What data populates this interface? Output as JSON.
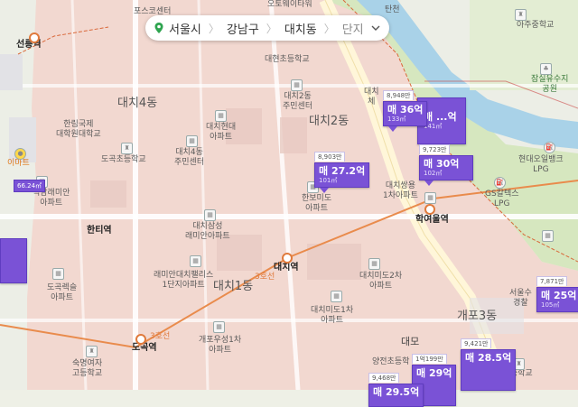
{
  "breadcrumb": {
    "city": "서울시",
    "district": "강남구",
    "dong": "대치동",
    "mode": "단지"
  },
  "labels": {
    "posco": "포스코센터",
    "okwoodwood": "오토웨이타워",
    "seolleung": "선릉역",
    "daecheon_school": "대현초등학교",
    "daechi4": "대치4동",
    "daechi2_center": "대치2동\n주민센터",
    "daechi2": "대치2동",
    "hanlim": "한림국제\n대학원대학교",
    "daechi_hyundai": "대치현대\n아파트",
    "dogok_school": "도곡초등학교",
    "daechi4_center": "대치4동\n주민센터",
    "emart": "이마트",
    "yeoksam_raemian": "역삼래미안\n아파트",
    "hanbo_mido": "한보미도\n아파트",
    "daechi_samsung": "대치삼성\n래미안아파트",
    "hanti": "한티역",
    "raemian_palace": "래미안대치팰리스\n1단지아파트",
    "daechi_stn": "대치역",
    "daechi1": "대치1동",
    "dogok_rexle": "도곡렉슬\n아파트",
    "daechi_mido2": "대치미도2차\n아파트",
    "daechi_mido1": "대치미도1차\n아파트",
    "gaepo_woosung": "개포우성1차\n아파트",
    "dogok_stn": "도곡역",
    "sookmyung": "숙명여자\n고등학교",
    "tancheon": "탄천",
    "ajoo_school": "아주중학교",
    "jamsil_park": "잠실유수지\n공원",
    "hyundai_lpg": "현대오일뱅크\nLPG",
    "gs_lpg": "GS칼텍스\nLPG",
    "hakyeoul": "학여울역",
    "daechi_hwa": "대치쌍용\n1차아파트",
    "gaepo3": "개포3동",
    "seoul_school": "서울수\n경찰",
    "ilwon_school": "일원초등학교",
    "yangjeon": "양전초등학",
    "daemo": "대모",
    "daechi_che": "대치\n체",
    "line3": "3호선"
  },
  "pins": [
    {
      "count": "8,948만",
      "price": "매 36억",
      "area": "133㎡"
    },
    {
      "count": "",
      "price": "매 ...억",
      "area": "141㎡"
    },
    {
      "count": "9,723만",
      "price": "매 30억",
      "area": "102㎡"
    },
    {
      "count": "8,903만",
      "price": "매 27.2억",
      "area": "101㎡"
    },
    {
      "count": "7,871만",
      "price": "매 25억",
      "area": "105㎡"
    },
    {
      "count": "9,421만",
      "price": "매 28.5억",
      "area": ""
    },
    {
      "count": "1억199만",
      "price": "매 29억",
      "area": ""
    },
    {
      "count": "9,468만",
      "price": "매 29.5억",
      "area": ""
    }
  ],
  "side_badge": "66.24㎡",
  "colors": {
    "pin": "#7a52d6",
    "district_fill": "#f2d4cf",
    "river": "#9fc9e3",
    "park": "#cfe3b4",
    "boundary": "#d9683a"
  }
}
